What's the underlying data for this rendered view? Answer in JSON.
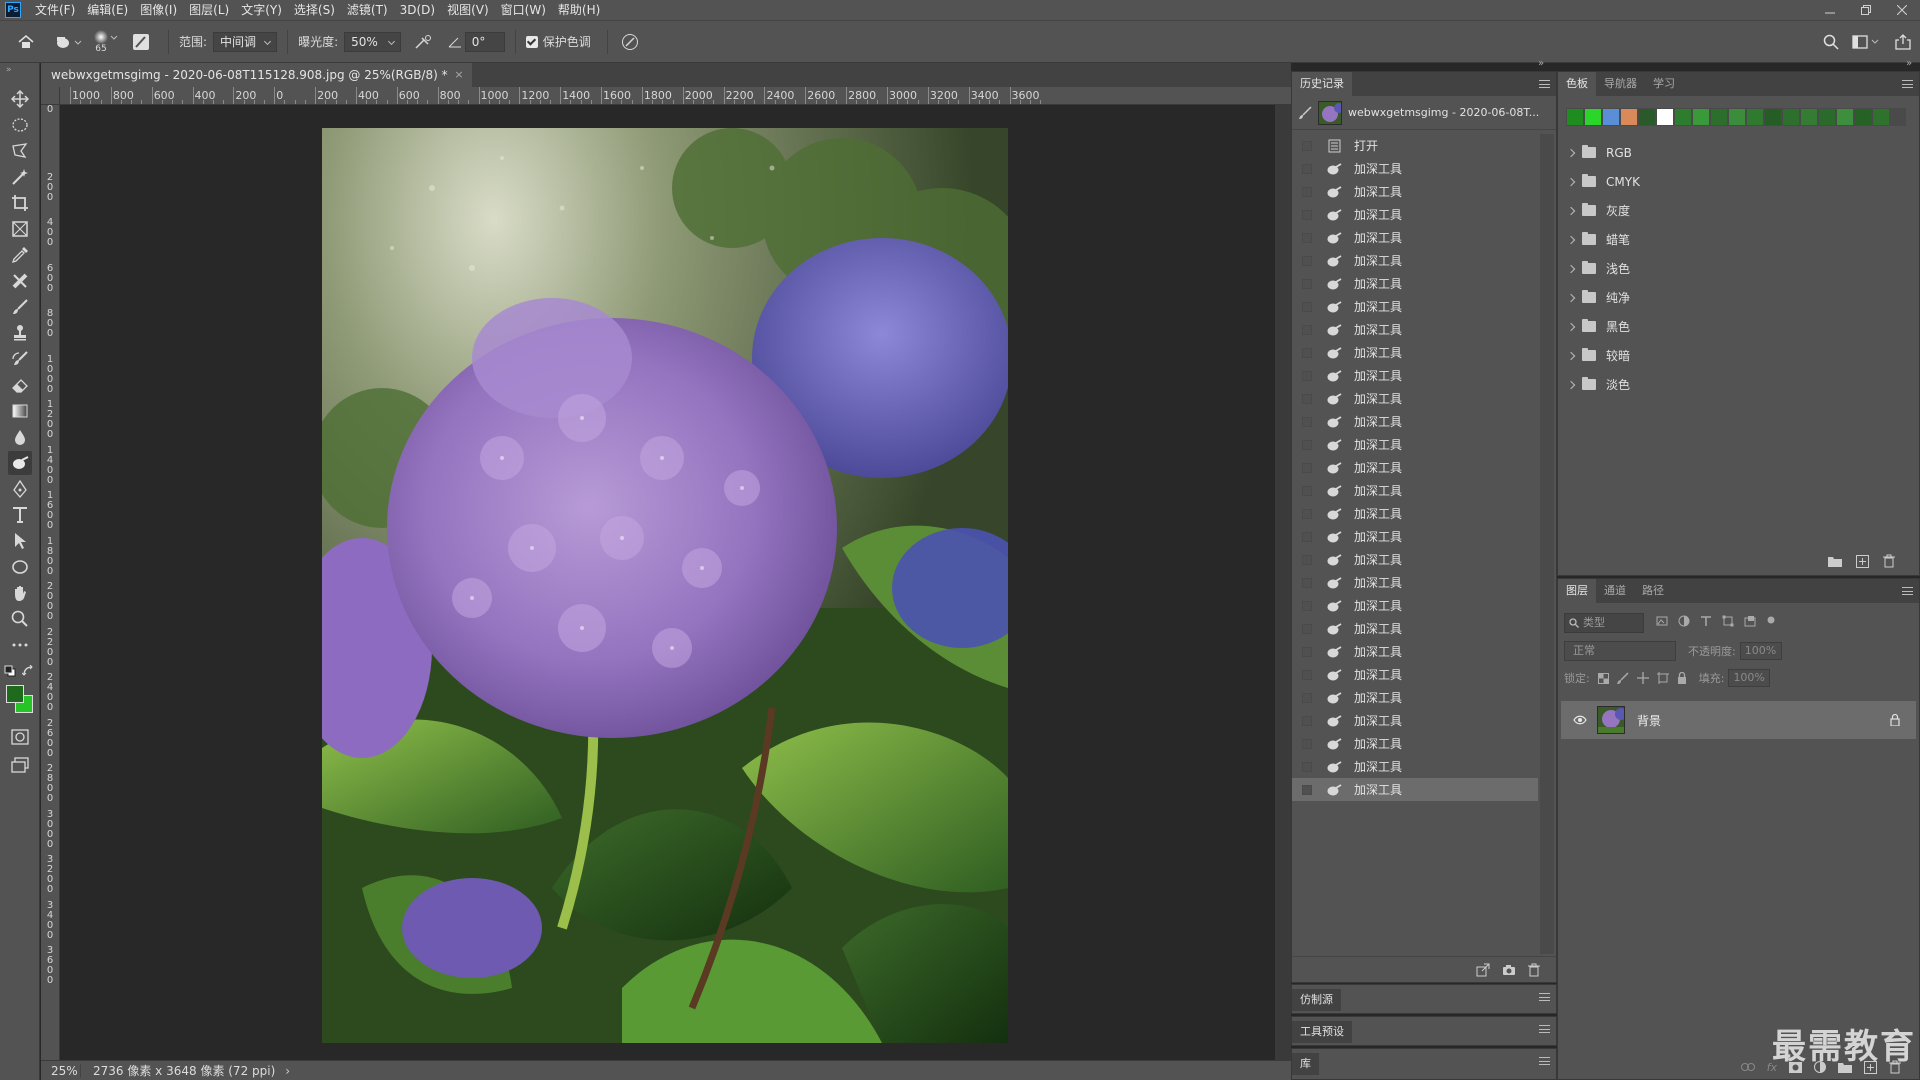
{
  "app": {
    "logo_text": "Ps"
  },
  "menu": [
    "文件(F)",
    "编辑(E)",
    "图像(I)",
    "图层(L)",
    "文字(Y)",
    "选择(S)",
    "滤镜(T)",
    "3D(D)",
    "视图(V)",
    "窗口(W)",
    "帮助(H)"
  ],
  "options": {
    "brush_size": "65",
    "range_label": "范围:",
    "range_value": "中间调",
    "exposure_label": "曝光度:",
    "exposure_value": "50%",
    "angle_value": "0°",
    "protect_tones_label": "保护色调",
    "protect_tones_checked": true
  },
  "document": {
    "tab_title": "webwxgetmsgimg - 2020-06-08T115128.908.jpg @ 25%(RGB/8) *",
    "zoom": "25%",
    "info": "2736 像素 x 3648 像素 (72 ppi)"
  },
  "ruler": {
    "h_labels": [
      "1000",
      "800",
      "600",
      "400",
      "200",
      "0",
      "200",
      "400",
      "600",
      "800",
      "1000",
      "1200",
      "1400",
      "1600",
      "1800",
      "2000",
      "2200",
      "2400",
      "2600",
      "2800",
      "3000",
      "3200",
      "3400",
      "3600"
    ],
    "v_labels": [
      "0",
      "0",
      "2\n0\n0",
      "4\n0\n0",
      "6\n0\n0",
      "8\n0\n0",
      "1\n0\n0\n0",
      "1\n2\n0\n0",
      "1\n4\n0\n0",
      "1\n6\n0\n0",
      "1\n8\n0\n0",
      "2\n0\n0\n0",
      "2\n2\n0\n0",
      "2\n4\n0\n0",
      "2\n6\n0\n0",
      "2\n8\n0\n0",
      "3\n0\n0\n0",
      "3\n2\n0\n0",
      "3\n4\n0\n0",
      "3\n6\n0\n0"
    ]
  },
  "history": {
    "tab": "历史记录",
    "snapshot_label": "webwxgetmsgimg - 2020-06-08T...",
    "items": [
      {
        "label": "打开",
        "icon": "document-icon"
      },
      {
        "label": "加深工具",
        "icon": "burn-tool-icon"
      },
      {
        "label": "加深工具",
        "icon": "burn-tool-icon"
      },
      {
        "label": "加深工具",
        "icon": "burn-tool-icon"
      },
      {
        "label": "加深工具",
        "icon": "burn-tool-icon"
      },
      {
        "label": "加深工具",
        "icon": "burn-tool-icon"
      },
      {
        "label": "加深工具",
        "icon": "burn-tool-icon"
      },
      {
        "label": "加深工具",
        "icon": "burn-tool-icon"
      },
      {
        "label": "加深工具",
        "icon": "burn-tool-icon"
      },
      {
        "label": "加深工具",
        "icon": "burn-tool-icon"
      },
      {
        "label": "加深工具",
        "icon": "burn-tool-icon"
      },
      {
        "label": "加深工具",
        "icon": "burn-tool-icon"
      },
      {
        "label": "加深工具",
        "icon": "burn-tool-icon"
      },
      {
        "label": "加深工具",
        "icon": "burn-tool-icon"
      },
      {
        "label": "加深工具",
        "icon": "burn-tool-icon"
      },
      {
        "label": "加深工具",
        "icon": "burn-tool-icon"
      },
      {
        "label": "加深工具",
        "icon": "burn-tool-icon"
      },
      {
        "label": "加深工具",
        "icon": "burn-tool-icon"
      },
      {
        "label": "加深工具",
        "icon": "burn-tool-icon"
      },
      {
        "label": "加深工具",
        "icon": "burn-tool-icon"
      },
      {
        "label": "加深工具",
        "icon": "burn-tool-icon"
      },
      {
        "label": "加深工具",
        "icon": "burn-tool-icon"
      },
      {
        "label": "加深工具",
        "icon": "burn-tool-icon"
      },
      {
        "label": "加深工具",
        "icon": "burn-tool-icon"
      },
      {
        "label": "加深工具",
        "icon": "burn-tool-icon"
      },
      {
        "label": "加深工具",
        "icon": "burn-tool-icon"
      },
      {
        "label": "加深工具",
        "icon": "burn-tool-icon"
      },
      {
        "label": "加深工具",
        "icon": "burn-tool-icon"
      },
      {
        "label": "加深工具",
        "icon": "burn-tool-icon"
      }
    ],
    "selected_index": 28
  },
  "clone_source": {
    "tab": "仿制源"
  },
  "tool_presets": {
    "tab": "工具预设"
  },
  "library": {
    "tab": "库"
  },
  "swatches": {
    "tabs": [
      "色板",
      "导航器",
      "学习"
    ],
    "colors": [
      "#1e8c1e",
      "#2ad62a",
      "#5a8fd8",
      "#d88a5a",
      "#2a5a2a",
      "#ffffff",
      "#2e7d2e",
      "#3a9a3a",
      "#2c6e2c",
      "#3b8c3b",
      "#2f7a2f",
      "#255e25",
      "#2d702d",
      "#347c34",
      "#2a6a2a",
      "#3d8f3d",
      "#266226",
      "#2e722e"
    ],
    "groups": [
      "RGB",
      "CMYK",
      "灰度",
      "蜡笔",
      "浅色",
      "纯净",
      "黑色",
      "较暗",
      "淡色"
    ]
  },
  "layers": {
    "tabs": [
      "图层",
      "通道",
      "路径"
    ],
    "filter_placeholder": "类型",
    "blend_mode": "正常",
    "opacity_label": "不透明度:",
    "opacity_value": "100%",
    "lock_label": "锁定:",
    "fill_label": "填充:",
    "fill_value": "100%",
    "layer_name": "背景"
  },
  "watermark": "最需教育",
  "colors": {
    "foreground": "#1e6b1e",
    "background": "#27c427",
    "accent": "#31a8ff"
  }
}
